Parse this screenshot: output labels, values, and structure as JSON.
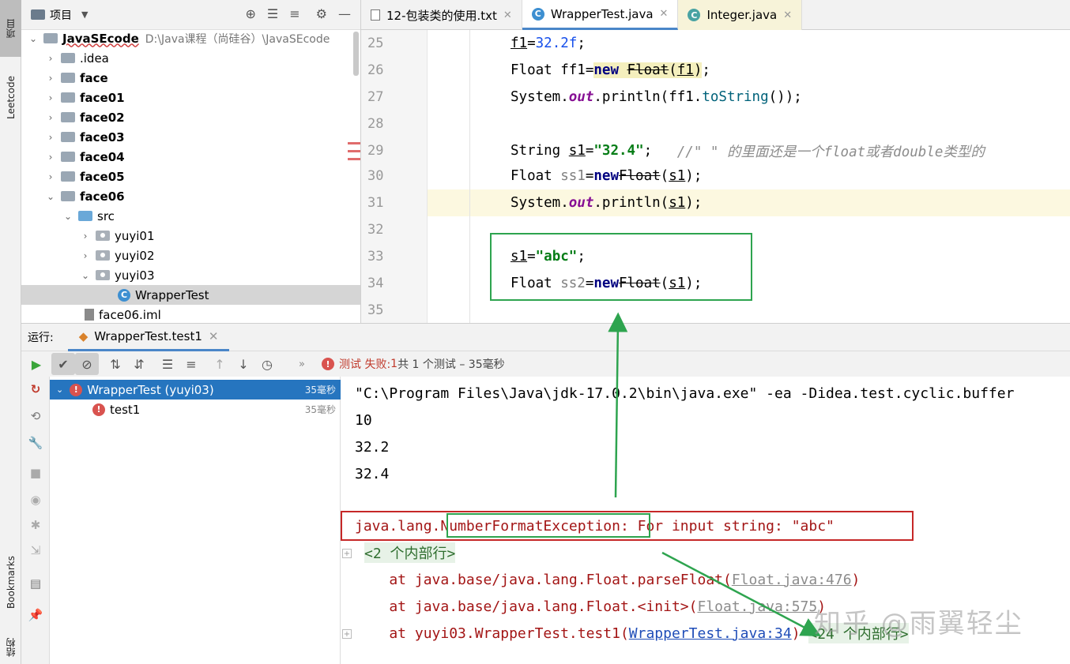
{
  "left_strip": {
    "project": "项目",
    "leetcode": "Leetcode",
    "bookmarks": "Bookmarks",
    "structure": "结构"
  },
  "project_panel": {
    "title": "项目",
    "root": {
      "name": "JavaSEcode",
      "path": "D:\\Java课程（尚硅谷）\\JavaSEcode"
    },
    "items": [
      ".idea",
      "face",
      "face01",
      "face02",
      "face03",
      "face04",
      "face05",
      "face06",
      "src",
      "yuyi01",
      "yuyi02",
      "yuyi03",
      "WrapperTest",
      "face06.iml"
    ]
  },
  "editor_tabs": [
    {
      "label": "12-包装类的使用.txt"
    },
    {
      "label": "WrapperTest.java"
    },
    {
      "label": "Integer.java"
    }
  ],
  "editor": {
    "line_numbers": [
      "25",
      "26",
      "27",
      "28",
      "29",
      "30",
      "31",
      "32",
      "33",
      "34",
      "35"
    ],
    "line25": {
      "var": "f1",
      "eq": "=",
      "val": "32.2f",
      "end": ";"
    },
    "line26": {
      "type": "Float ",
      "var": "ff1",
      "eq": "=",
      "kw": "new",
      "cls": "Float",
      "paren_open": "(",
      "arg": "f1",
      "paren_close": ")",
      "end": ";"
    },
    "line27": {
      "a": "System.",
      "out": "out",
      "b": ".println(ff1.",
      "meth": "toString",
      "c": "());"
    },
    "line29": {
      "type": "String ",
      "var": "s1",
      "eq": "=",
      "val": "\"32.4\"",
      "end": ";   ",
      "comment": "//\" \" 的里面还是一个float或者double类型的"
    },
    "line30": {
      "type": "Float ",
      "var": "ss1",
      "eq": "=",
      "kw": "new",
      "cls": "Float",
      "a": "(",
      "arg": "s1",
      "b": ");"
    },
    "line31": {
      "a": "System.",
      "out": "out",
      "b": ".println(",
      "arg": "s1",
      "c": ");"
    },
    "line33": {
      "var": "s1",
      "eq": "=",
      "val": "\"abc\"",
      "end": ";"
    },
    "line34": {
      "type": "Float ",
      "var": "ss2",
      "eq": "=",
      "kw": "new",
      "cls": "Float",
      "a": "(",
      "arg": "s1",
      "b": ");"
    }
  },
  "run_panel": {
    "label": "运行:",
    "tab": "WrapperTest.test1",
    "status_fail": "测试 失败: ",
    "status_count": "1",
    "status_rest": "共 1 个测试 – 35毫秒",
    "tree": [
      {
        "name": "WrapperTest (yuyi03)",
        "time": "35毫秒"
      },
      {
        "name": "test1",
        "time": "35毫秒"
      }
    ]
  },
  "console": {
    "cmd": "\"C:\\Program Files\\Java\\jdk-17.0.2\\bin\\java.exe\" -ea -Didea.test.cyclic.buffer",
    "out1": "10",
    "out2": "32.2",
    "out3": "32.4",
    "exc_prefix": "java.lang.",
    "exc_name": "NumberFormatException",
    "exc_msg": ": For input string: \"abc\"",
    "internal1": "<2 个内部行>",
    "st1_a": "    at java.base/java.lang.Float.parseFloat(",
    "st1_link": "Float.java:476",
    "st1_b": ")",
    "st2_a": "    at java.base/java.lang.Float.<init>(",
    "st2_link": "Float.java:575",
    "st2_b": ")",
    "st3_a": "    at yuyi03.WrapperTest.test1(",
    "st3_link": "WrapperTest.java:34",
    "st3_b": ") ",
    "internal2": "<24 个内部行>"
  },
  "watermark": "知乎 @雨翼轻尘",
  "colors": {
    "accent": "#4a86c8",
    "error": "#c62828",
    "annotation_green": "#2ea44f"
  }
}
